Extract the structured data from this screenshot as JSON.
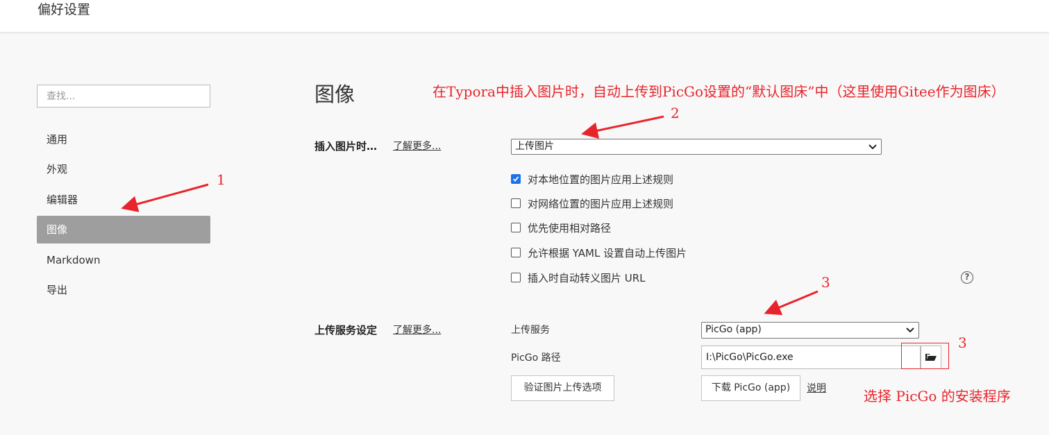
{
  "window": {
    "title": "偏好设置"
  },
  "sidebar": {
    "search_placeholder": "查找...",
    "items": [
      {
        "label": "通用"
      },
      {
        "label": "外观"
      },
      {
        "label": "编辑器"
      },
      {
        "label": "图像",
        "active": true
      },
      {
        "label": "Markdown"
      },
      {
        "label": "导出"
      }
    ]
  },
  "main": {
    "title": "图像",
    "insert_section": {
      "label": "插入图片时…",
      "learn_more": "了解更多...",
      "select_value": "上传图片",
      "checkboxes": [
        {
          "label": "对本地位置的图片应用上述规则",
          "checked": true
        },
        {
          "label": "对网络位置的图片应用上述规则",
          "checked": false
        },
        {
          "label": "优先使用相对路径",
          "checked": false
        },
        {
          "label": "允许根据 YAML 设置自动上传图片",
          "checked": false
        },
        {
          "label": "插入时自动转义图片 URL",
          "checked": false
        }
      ],
      "help_icon": "question-circle-icon"
    },
    "upload_section": {
      "label": "上传服务设定",
      "learn_more": "了解更多...",
      "service_label": "上传服务",
      "service_value": "PicGo (app)",
      "path_label": "PicGo 路径",
      "path_value": "I:\\PicGo\\PicGo.exe",
      "folder_icon": "folder-open-icon",
      "verify_button": "验证图片上传选项",
      "download_button": "下载 PicGo (app)",
      "docs_link": "说明"
    }
  },
  "annotations": {
    "color": "#e8242b",
    "header_note": "在Typora中插入图片时，自动上传到PicGo设置的“默认图床”中（这里使用Gitee作为图床）",
    "num_1": "1",
    "num_2": "2",
    "num_3a": "3",
    "num_3b": "3",
    "picgo_note": "选择 PicGo 的安装程序"
  }
}
